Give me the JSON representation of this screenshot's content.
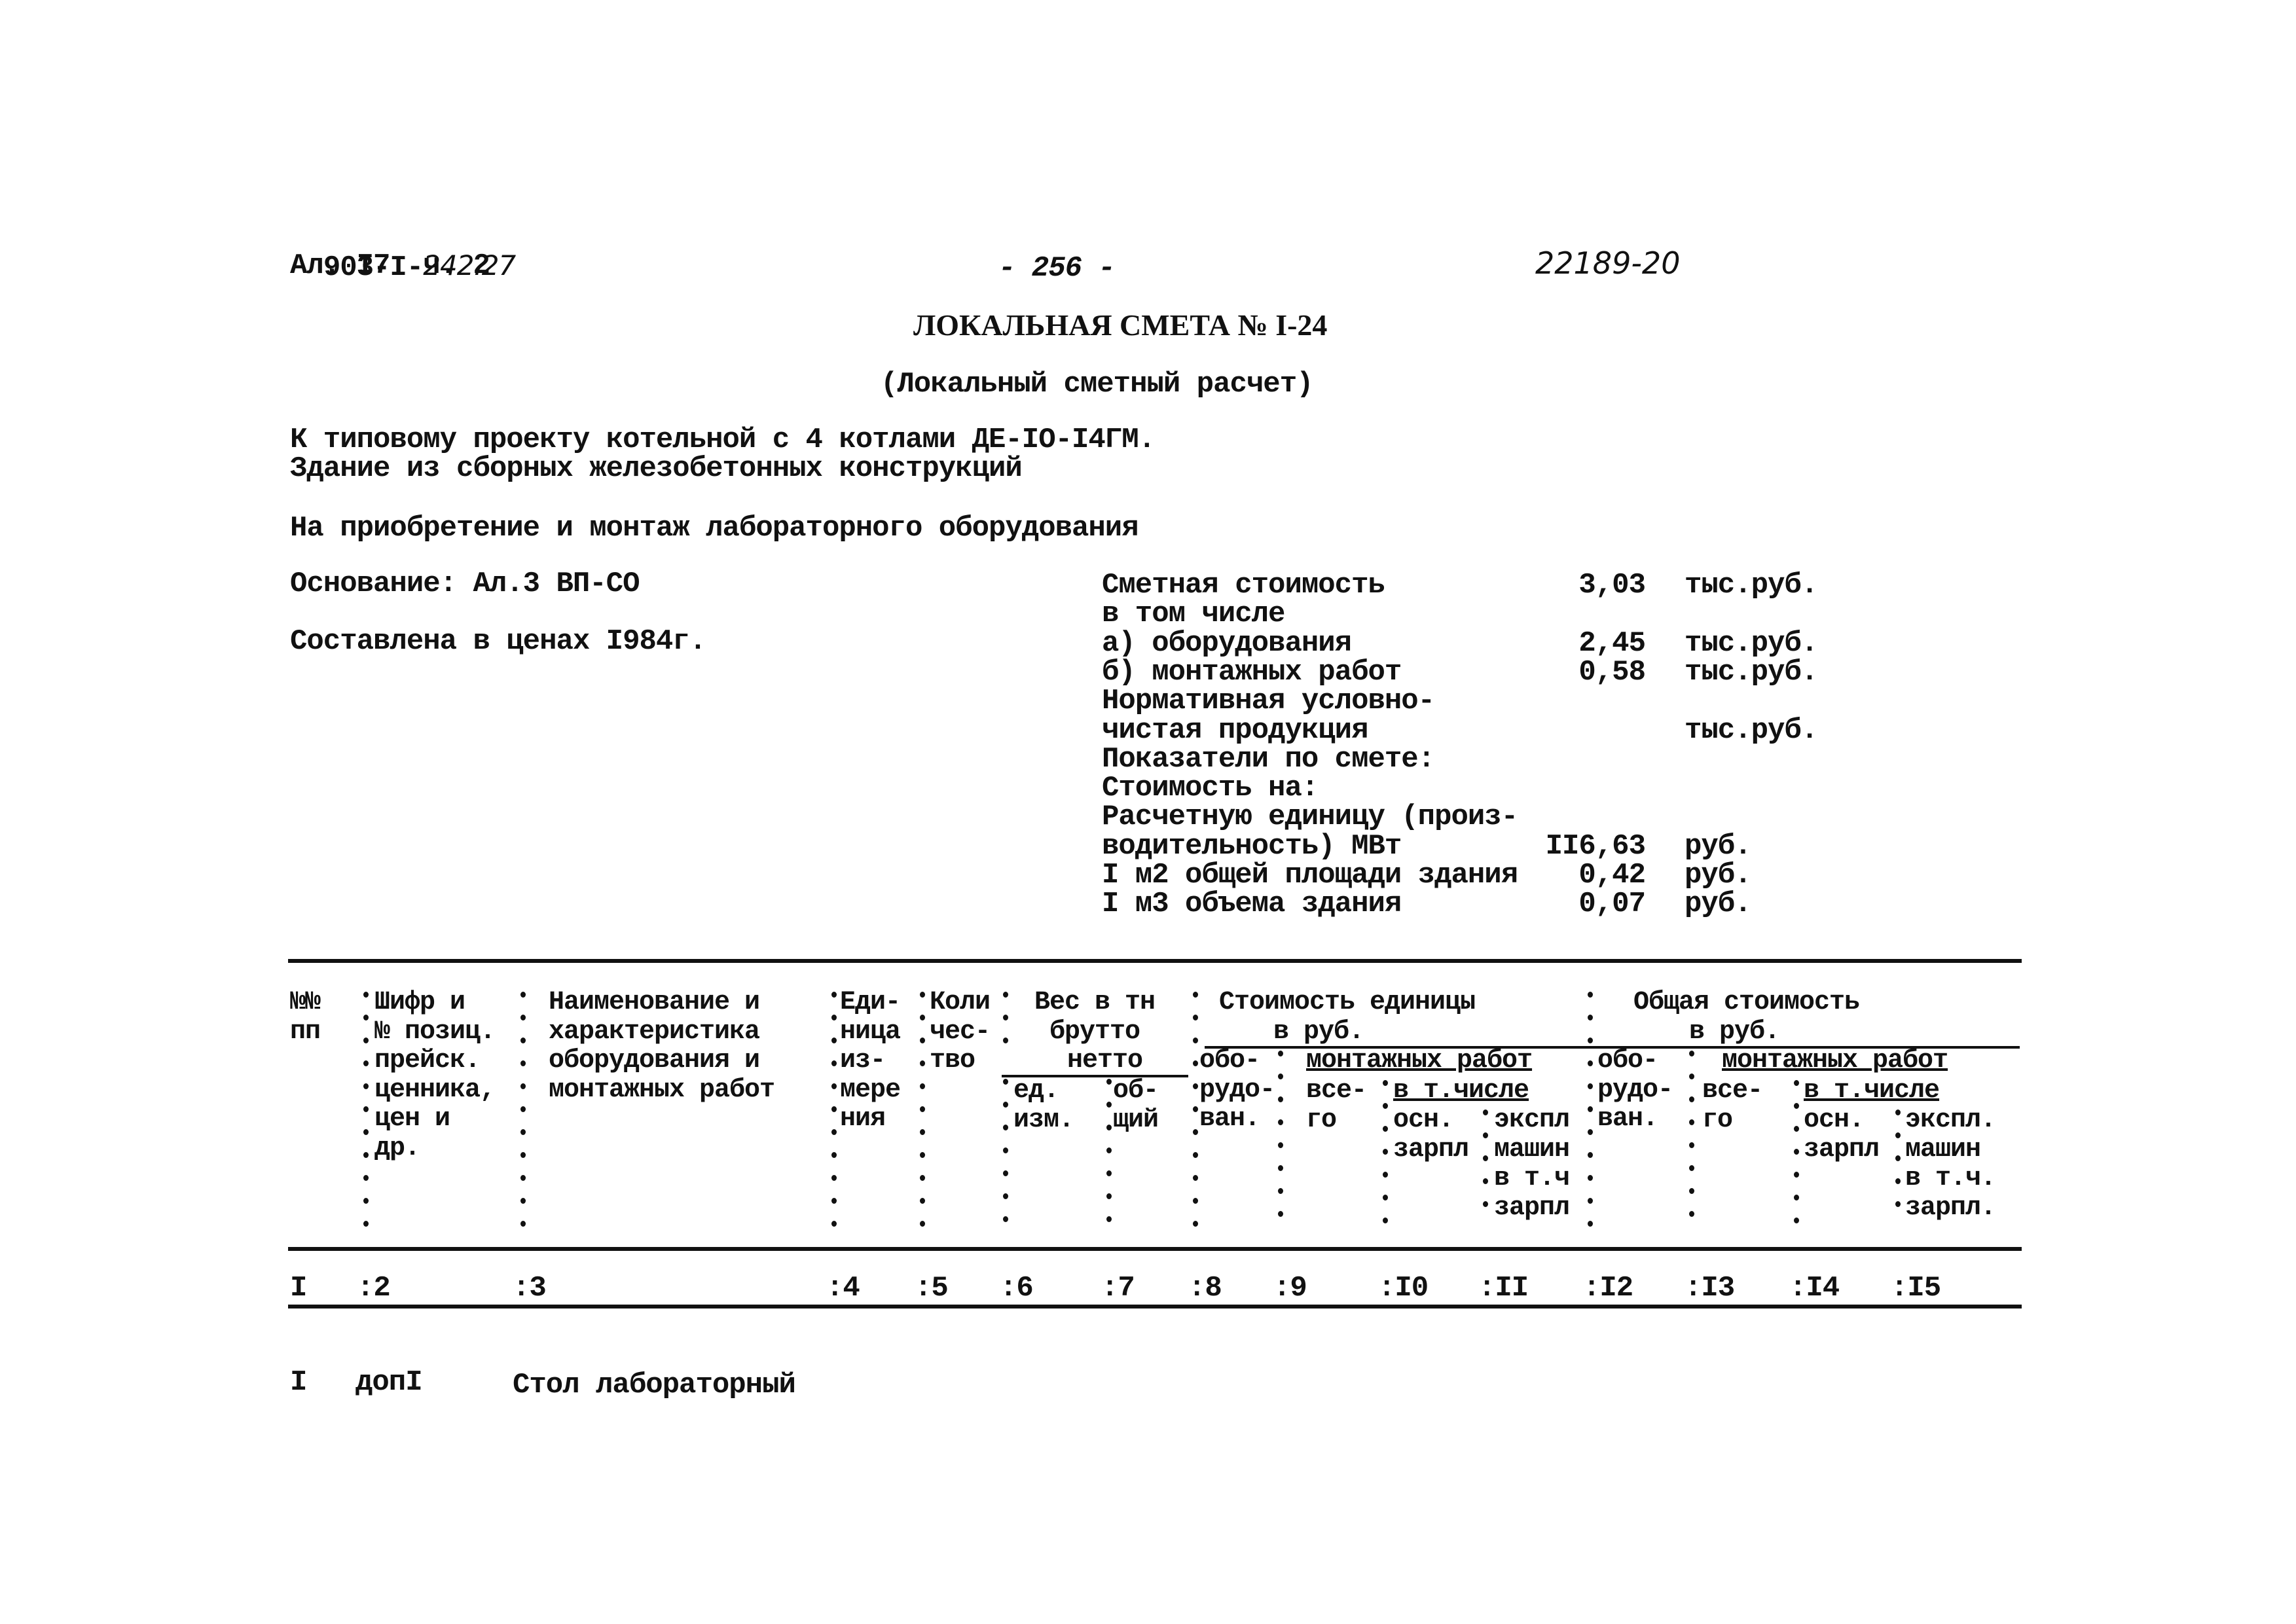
{
  "header": {
    "doc_code_line1": "903-I-",
    "doc_code_handwritten": "242.27",
    "doc_code_line2": "Ал. I7  ч. 2",
    "page_number": "- 256 -",
    "inventory_number": "22189-20"
  },
  "title": {
    "main": "ЛОКАЛЬНАЯ СМЕТА № I-24",
    "subtitle": "(Локальный сметный расчет)"
  },
  "project": {
    "line1": "К типовому проекту котельной с 4 котлами ДЕ-IO-I4ГМ.",
    "line2": "Здание из сборных железобетонных конструкций",
    "purpose": "На приобретение и монтаж лабораторного оборудования",
    "basis": "Основание: Ал.3 ВП-СО",
    "prices": "Составлена в ценах I984г."
  },
  "summary": {
    "rows": [
      {
        "label": "Сметная стоимость",
        "value": "3,03",
        "unit": "тыс.руб."
      },
      {
        "label": "в том числе",
        "value": "",
        "unit": ""
      },
      {
        "label": "а) оборудования",
        "value": "2,45",
        "unit": "тыс.руб."
      },
      {
        "label": "б) монтажных работ",
        "value": "0,58",
        "unit": "тыс.руб."
      },
      {
        "label": "Нормативная условно-",
        "value": "",
        "unit": ""
      },
      {
        "label": "чистая продукция",
        "value": "",
        "unit": "тыс.руб."
      },
      {
        "label": "Показатели по смете:",
        "value": "",
        "unit": ""
      },
      {
        "label": "Стоимость на:",
        "value": "",
        "unit": ""
      },
      {
        "label": "Расчетную единицу (произ-",
        "value": "",
        "unit": ""
      },
      {
        "label": "водительность) МВт",
        "value": "II6,63",
        "unit": "руб."
      },
      {
        "label": "I м2 общей площади здания",
        "value": "0,42",
        "unit": "руб."
      },
      {
        "label": "I м3 объема здания",
        "value": "0,07",
        "unit": "руб."
      }
    ]
  },
  "table": {
    "headers": {
      "c1": "№№\nпп",
      "c2": "Шифр и\n№ позиц.\nпрейск.\nценника,\nцен и\nдр.",
      "c3": "Наименование и\nхарактеристика\nоборудования и\nмонтажных работ",
      "c4": "Еди-\nница\nиз-\nмере\nния",
      "c5": "Коли\nчес-\nтво",
      "weight_group": "Вес в тн",
      "weight_brutto": "брутто",
      "weight_netto": "нетто",
      "c6": "ед.\nизм.",
      "c7": "об-\nщий",
      "unit_cost_group": "Стоимость единицы",
      "unit_cost_sub": "в руб.",
      "c8": "обо-\nрудо-\nван.",
      "unit_mount_group": "монтажных работ",
      "c9": "все-\nго",
      "unit_incl": "в т.числе",
      "c10": "осн.\nзарпл",
      "c11": "экспл\nмашин\nв т.ч\nзарпл",
      "total_cost_group": "Общая стоимость",
      "total_cost_sub": "в руб.",
      "c12": "обо-\nрудо-\nван.",
      "total_mount_group": "монтажных работ",
      "c13": "все-\nго",
      "total_incl": "в т.числе",
      "c14": "осн.\nзарпл",
      "c15": "экспл.\nмашин\nв т.ч.\nзарпл."
    },
    "column_numbers": [
      "I",
      ":2",
      ":3",
      ":4",
      ":5",
      ":6",
      ":7",
      ":8",
      ":9",
      ":I0",
      ":II",
      ":I2",
      ":I3",
      ":I4",
      ":I5"
    ],
    "rows": [
      {
        "num": "I",
        "code": "допI",
        "name": "Стол лабораторный"
      }
    ]
  }
}
